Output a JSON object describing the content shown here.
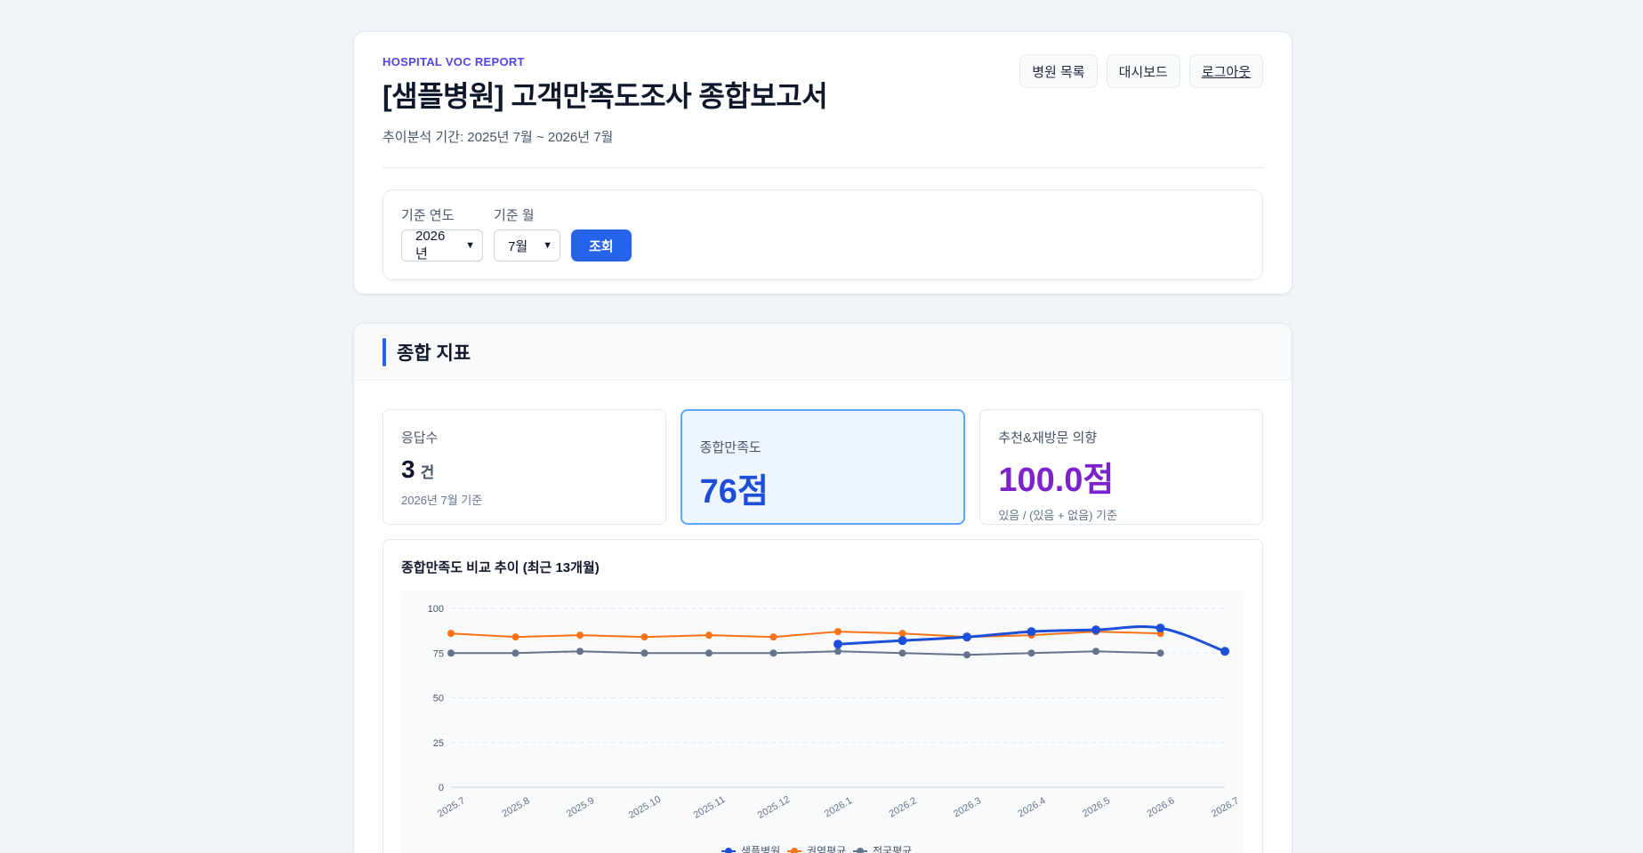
{
  "header": {
    "eyebrow": "HOSPITAL VOC REPORT",
    "title": "[샘플병원] 고객만족도조사 종합보고서",
    "period": "추이분석 기간: 2025년 7월 ~ 2026년 7월",
    "nav": {
      "hospital_list": "병원 목록",
      "dashboard": "대시보드",
      "logout": "로그아웃"
    }
  },
  "filters": {
    "year_label": "기준 연도",
    "year_value": "2026년",
    "month_label": "기준 월",
    "month_value": "7월",
    "search_button": "조회"
  },
  "summary": {
    "section_title": "종합 지표",
    "responses": {
      "label": "응답수",
      "value": "3",
      "unit": "건",
      "sub": "2026년 7월 기준"
    },
    "satisfaction": {
      "label": "종합만족도",
      "value": "76점"
    },
    "recommend": {
      "label": "추천&재방문 의향",
      "value": "100.0점",
      "sub": "있음 / (있음 + 없음) 기준"
    }
  },
  "chart_data": {
    "type": "line",
    "title": "종합만족도 비교 추이 (최근 13개월)",
    "categories": [
      "2025.7",
      "2025.8",
      "2025.9",
      "2025.10",
      "2025.11",
      "2025.12",
      "2026.1",
      "2026.2",
      "2026.3",
      "2026.4",
      "2026.5",
      "2026.6",
      "2026.7"
    ],
    "ylim": [
      0,
      100
    ],
    "yticks": [
      0,
      25,
      50,
      75,
      100
    ],
    "grid": true,
    "legend_position": "bottom",
    "series": [
      {
        "name": "샘플병원",
        "color": "#1d4ed8",
        "smooth": true,
        "values": [
          null,
          null,
          null,
          null,
          null,
          null,
          80,
          82,
          84,
          87,
          88,
          89,
          76
        ]
      },
      {
        "name": "권역평균",
        "color": "#f97316",
        "values": [
          86,
          84,
          85,
          84,
          85,
          84,
          87,
          86,
          84,
          85,
          87,
          86,
          null
        ]
      },
      {
        "name": "전국평균",
        "color": "#64748b",
        "values": [
          75,
          75,
          76,
          75,
          75,
          75,
          76,
          75,
          74,
          75,
          76,
          75,
          null
        ]
      }
    ]
  }
}
